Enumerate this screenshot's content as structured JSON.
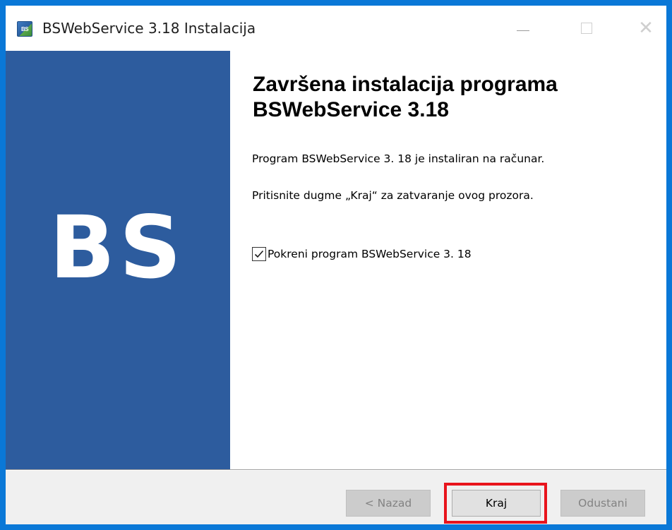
{
  "window": {
    "title": "BSWebService 3.18 Instalacija",
    "app_icon": "bs-app-icon",
    "accent_color": "#0a78d7"
  },
  "caption_buttons": {
    "minimize_icon": "minimize-icon",
    "maximize_icon": "maximize-icon",
    "close_icon": "close-icon",
    "close_glyph": "✕"
  },
  "side_panel": {
    "logo_text": "BS",
    "color": "#2d5c9e"
  },
  "main": {
    "heading_line1": "Završena instalacija programa",
    "heading_line2": "BSWebService 3.18",
    "text1": "Program BSWebService 3. 18 je instaliran na računar.",
    "text2": "Pritisnite dugme „Kraj“ za zatvaranje ovog prozora.",
    "checkbox": {
      "label": "Pokreni program BSWebService 3. 18",
      "checked": true
    }
  },
  "footer": {
    "back_label": "< Nazad",
    "finish_label": "Kraj",
    "cancel_label": "Odustani",
    "highlight_color": "#e8141c"
  }
}
